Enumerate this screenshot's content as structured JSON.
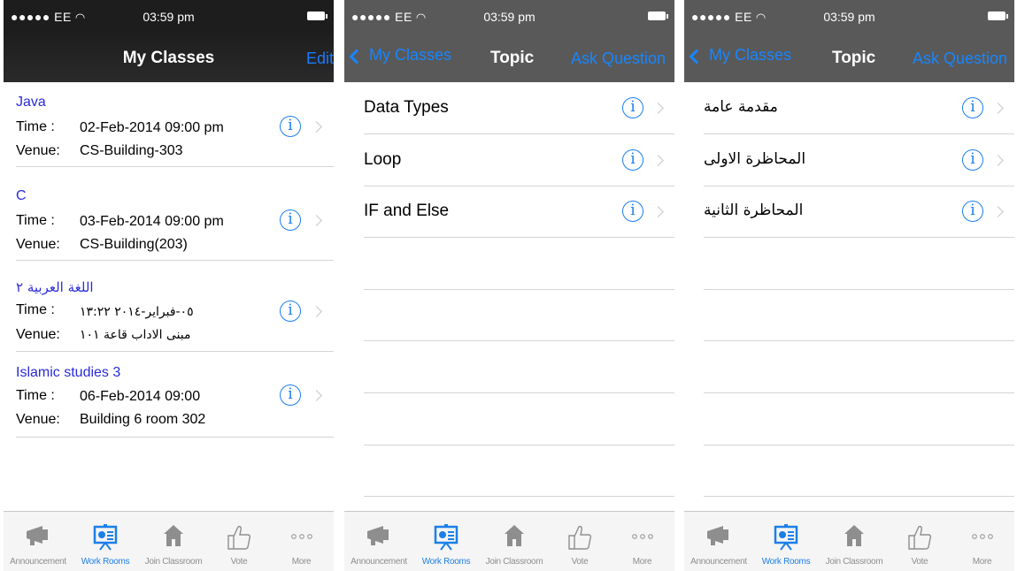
{
  "status_bar": {
    "carrier": "●●●●● EE",
    "time": "03:59 pm"
  },
  "screen1": {
    "nav": {
      "title": "My Classes",
      "right_button": "Edit"
    },
    "labels": {
      "time": "Time :",
      "venue": "Venue:"
    },
    "classes": [
      {
        "name": "Java",
        "time": "02-Feb-2014 09:00 pm",
        "venue": "CS-Building-303"
      },
      {
        "name": "C",
        "time": "03-Feb-2014 09:00 pm",
        "venue": "CS-Building(203)"
      },
      {
        "name": "اللغة العربية ٢",
        "time": "٠٥-فبراير-٢٠١٤ ١٣:٢٢",
        "venue": "مبنى الاداب قاعة ١٠١"
      },
      {
        "name": "Islamic studies 3",
        "time": "06-Feb-2014 09:00",
        "venue": "Building 6 room 302"
      }
    ]
  },
  "screen2": {
    "nav": {
      "back": "My Classes",
      "title": "Topic",
      "right_button": "Ask Question"
    },
    "topics": [
      "Data Types",
      "Loop",
      "IF and Else"
    ]
  },
  "screen3": {
    "nav": {
      "back": "My Classes",
      "title": "Topic",
      "right_button": "Ask Question"
    },
    "topics": [
      "مقدمة عامة",
      "المحاظرة الاولى",
      "المحاظرة الثانية"
    ]
  },
  "tabbar": {
    "items": [
      "Announcement",
      "Work Rooms",
      "Join Classroom",
      "Vote",
      "More"
    ],
    "active_index": 1
  },
  "colors": {
    "accent": "#1c7fe8",
    "class_name": "#2b2bd8",
    "nav_dark": "#1d1d1d",
    "nav_gray": "#595959"
  }
}
